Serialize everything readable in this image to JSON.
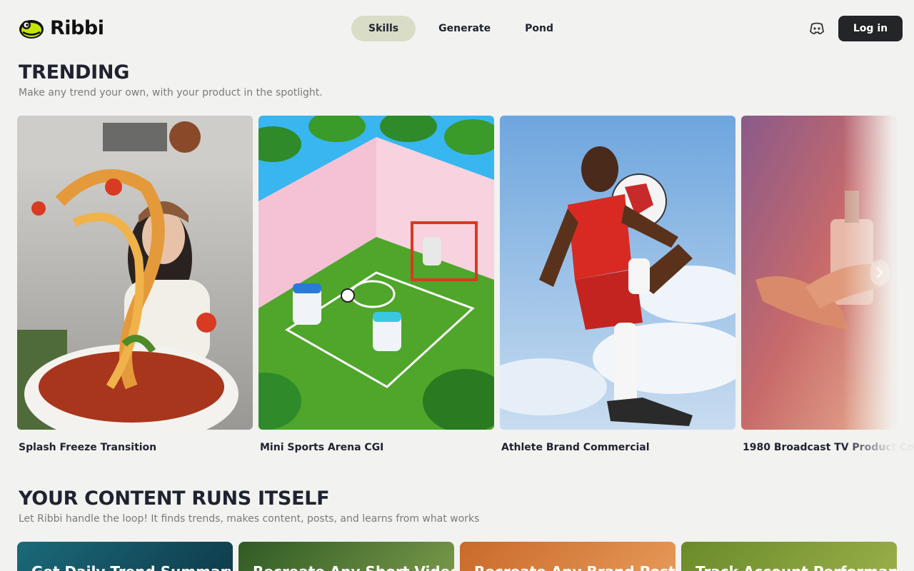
{
  "header": {
    "logo_text": "Ribbi",
    "nav": [
      "Skills",
      "Generate",
      "Pond"
    ],
    "active_nav": "Skills",
    "login_label": "Log in"
  },
  "trending": {
    "title": "TRENDING",
    "subtitle": "Make any trend your own, with your product in the spotlight.",
    "cards": [
      {
        "label": "Splash Freeze Transition"
      },
      {
        "label": "Mini Sports Arena CGI"
      },
      {
        "label": "Athlete Brand Commercial"
      },
      {
        "label": "1980 Broadcast TV Product Co"
      }
    ]
  },
  "content": {
    "title": "YOUR CONTENT RUNS ITSELF",
    "subtitle": "Let Ribbi handle the loop! It finds trends, makes content, posts, and learns from what works",
    "cards": [
      {
        "label": "Get Daily Trend Summary"
      },
      {
        "label": "Recreate Any Short Video"
      },
      {
        "label": "Recreate Any Brand Post"
      },
      {
        "label": "Track Account Performance"
      }
    ]
  },
  "colors": {
    "background": "#f2f2f0",
    "active_nav": "#d9dcc6",
    "login_bg": "#232528",
    "logo_green": "#c4e500"
  },
  "icons": [
    "frog-logo-icon",
    "discord-icon",
    "chevron-right-icon"
  ]
}
